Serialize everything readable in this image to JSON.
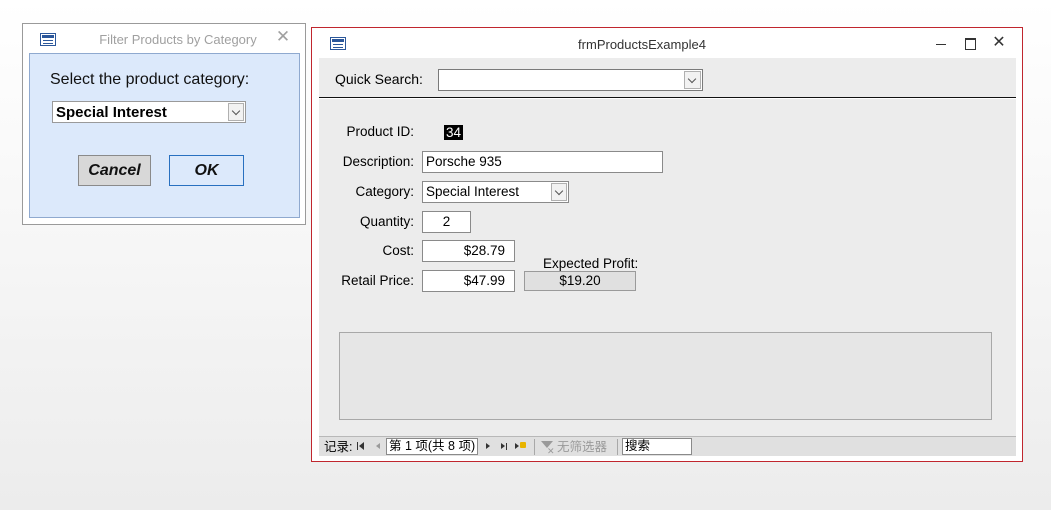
{
  "dialog": {
    "title": "Filter Products by Category",
    "prompt": "Select the product category:",
    "category_value": "Special Interest",
    "cancel_label": "Cancel",
    "ok_label": "OK"
  },
  "form": {
    "title": "frmProductsExample4",
    "quick_search_label": "Quick Search:",
    "quick_search_value": "",
    "fields": {
      "product_id_label": "Product ID:",
      "product_id": "34",
      "description_label": "Description:",
      "description": "Porsche 935",
      "category_label": "Category:",
      "category": "Special Interest",
      "quantity_label": "Quantity:",
      "quantity": "2",
      "cost_label": "Cost:",
      "cost": "$28.79",
      "retail_label": "Retail Price:",
      "retail": "$47.99",
      "profit_label": "Expected Profit:",
      "profit": "$19.20"
    },
    "navigation": {
      "label": "记录:",
      "record_position": "第 1 项(共 8 项)",
      "filter_status": "无筛选器",
      "search_label": "搜索"
    }
  },
  "colors": {
    "dialog_body_bg": "#dce9fb",
    "form_border": "#c0262e",
    "form_bg": "#ececec"
  }
}
